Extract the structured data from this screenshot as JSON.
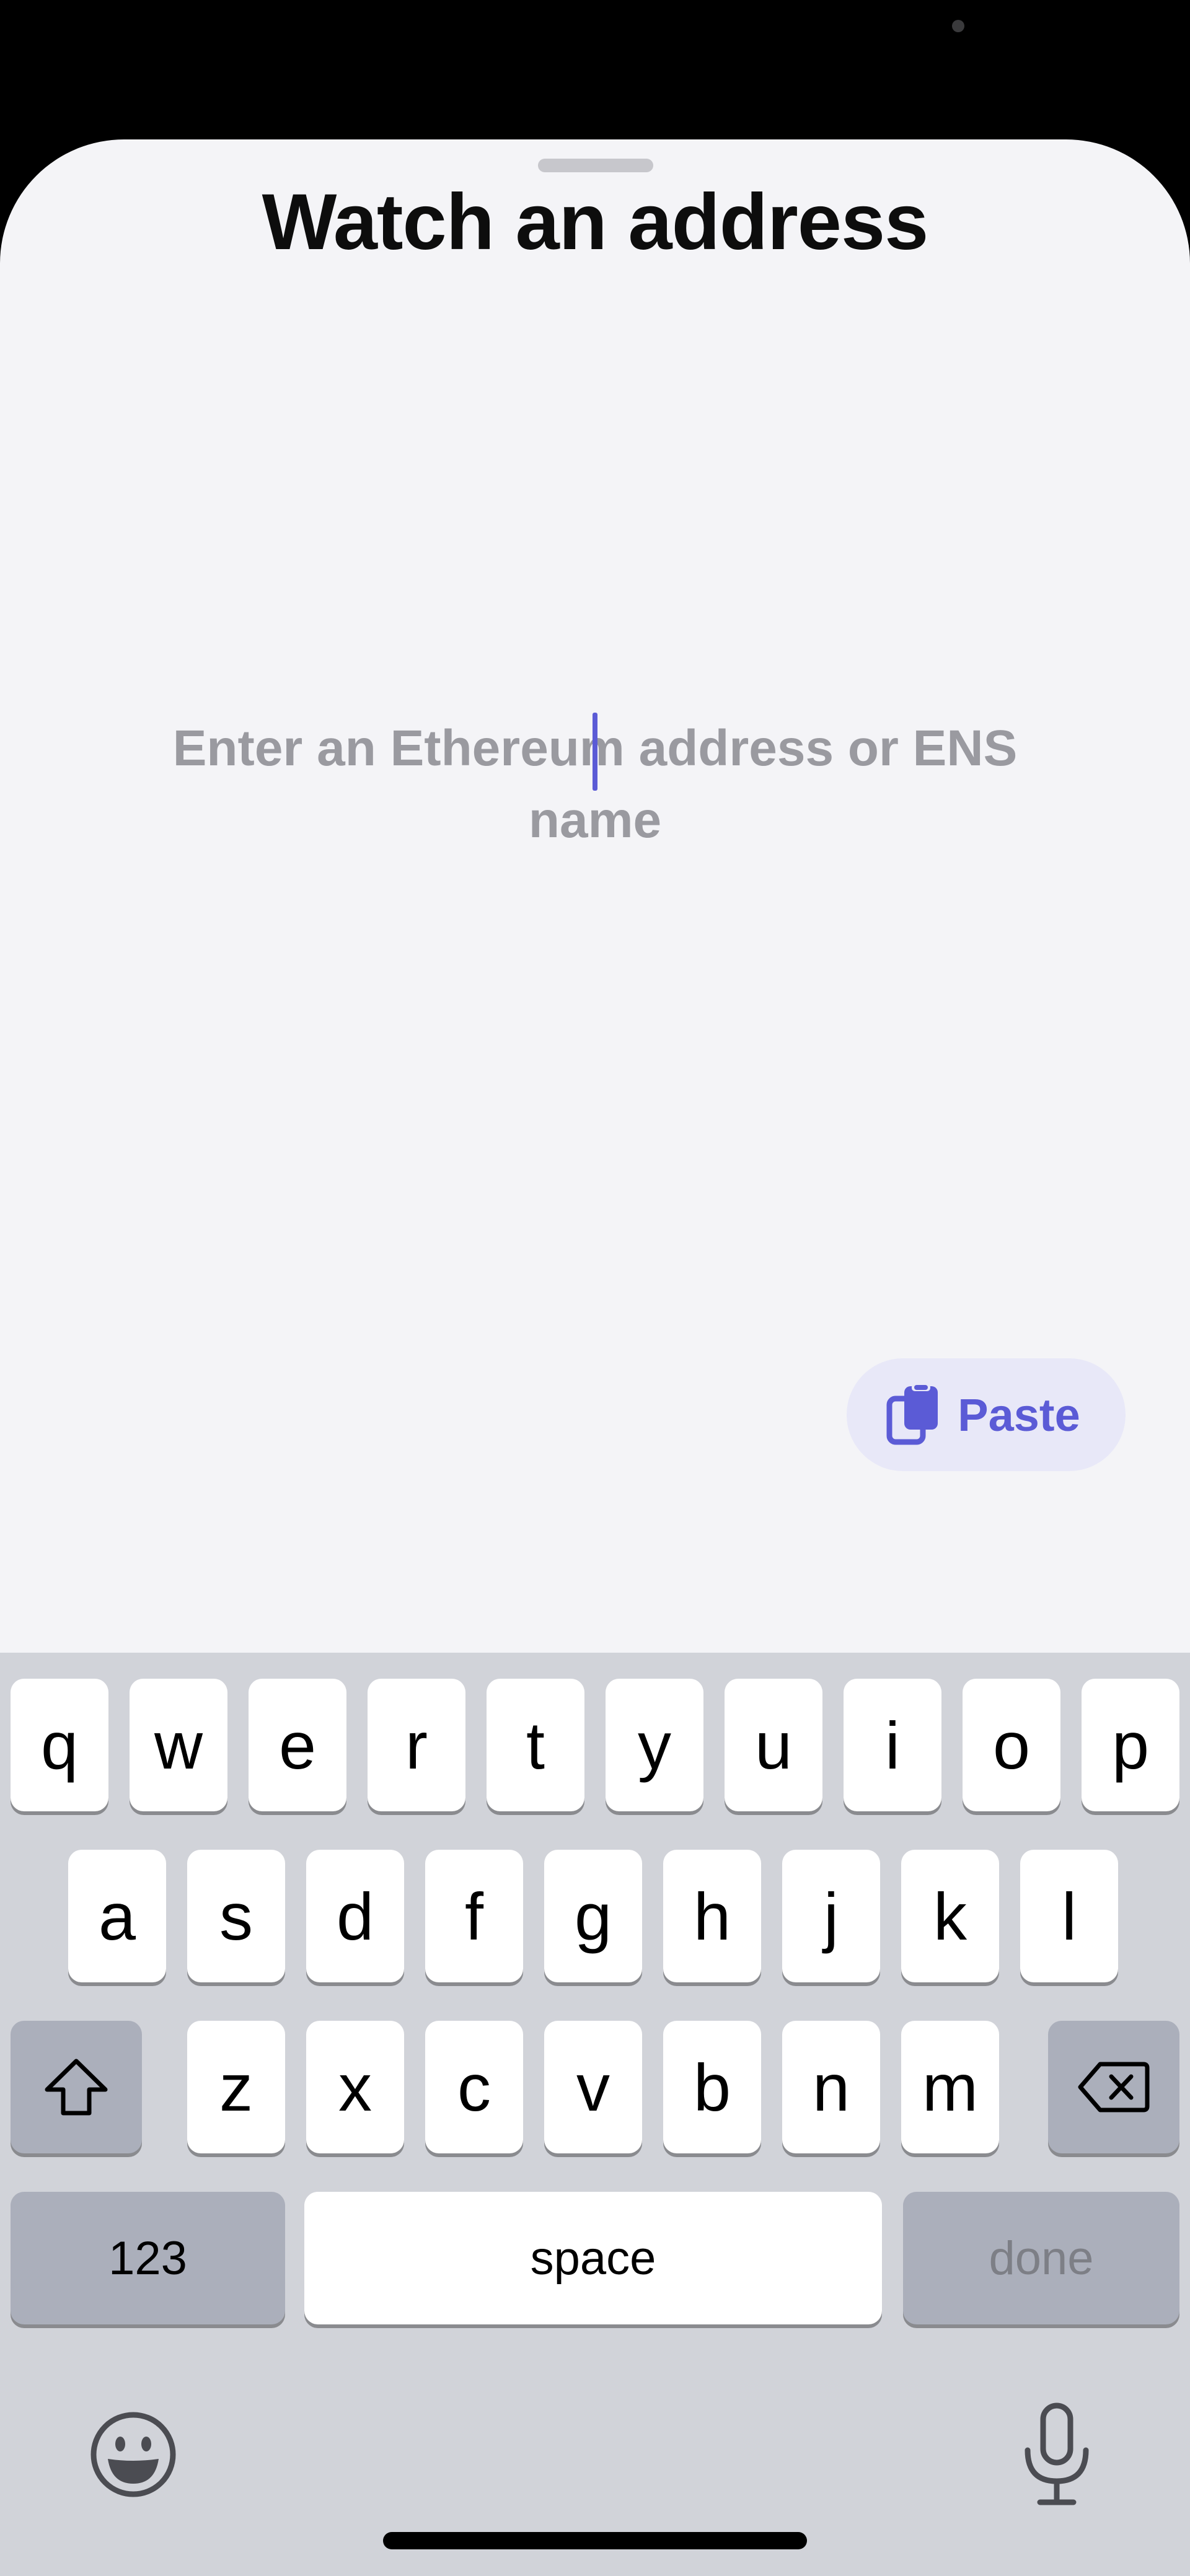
{
  "sheet": {
    "title": "Watch an address"
  },
  "address_input": {
    "placeholder": "Enter an Ethereum address or ENS name",
    "value": ""
  },
  "paste_button": {
    "label": "Paste",
    "icon": "clipboard-icon"
  },
  "keyboard": {
    "row1": [
      "q",
      "w",
      "e",
      "r",
      "t",
      "y",
      "u",
      "i",
      "o",
      "p"
    ],
    "row2": [
      "a",
      "s",
      "d",
      "f",
      "g",
      "h",
      "j",
      "k",
      "l"
    ],
    "row3": [
      "z",
      "x",
      "c",
      "v",
      "b",
      "n",
      "m"
    ],
    "numbers_label": "123",
    "space_label": "space",
    "done_label": "done",
    "shift_icon": "shift-icon",
    "delete_icon": "backspace-icon",
    "emoji_icon": "emoji-icon",
    "dictation_icon": "microphone-icon"
  },
  "colors": {
    "accent": "#5b5bd6",
    "sheet_background": "#f4f4f7",
    "keyboard_background": "#d1d3d9",
    "placeholder": "#9a9aa0"
  }
}
